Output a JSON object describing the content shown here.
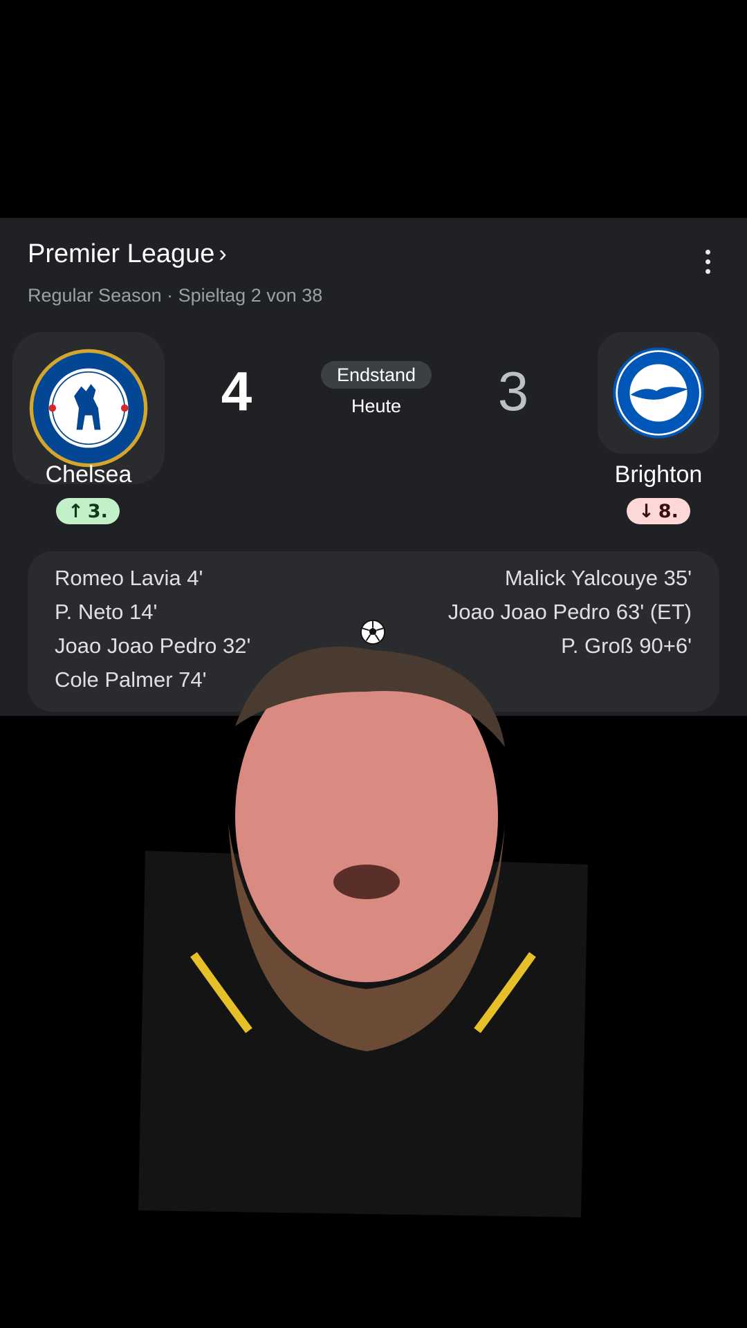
{
  "league": {
    "title": "Premier League",
    "chevron": "›",
    "subtitle": "Regular Season · Spieltag 2 von 38"
  },
  "match": {
    "status": "Endstand",
    "date": "Heute",
    "home": {
      "name": "Chelsea",
      "score": "4",
      "rank": "3.",
      "rank_arrow": "↑",
      "crest_icon": "chelsea-crest-icon"
    },
    "away": {
      "name": "Brighton",
      "score": "3",
      "rank": "8.",
      "rank_arrow": "↓",
      "crest_icon": "brighton-crest-icon"
    }
  },
  "scorers": {
    "home": [
      "Romeo Lavia 4'",
      "P. Neto 14'",
      "Joao Joao Pedro 32'",
      "Cole Palmer 74'"
    ],
    "away": [
      "Malick Yalcouye 35'",
      "Joao Joao Pedro 63' (ET)",
      "P. Groß 90+6'"
    ]
  },
  "colors": {
    "card_bg": "#202124",
    "rank_up": "#c3efc9",
    "rank_down": "#fcd8d7",
    "chelsea_blue": "#034694",
    "brighton_blue": "#0057b8"
  }
}
